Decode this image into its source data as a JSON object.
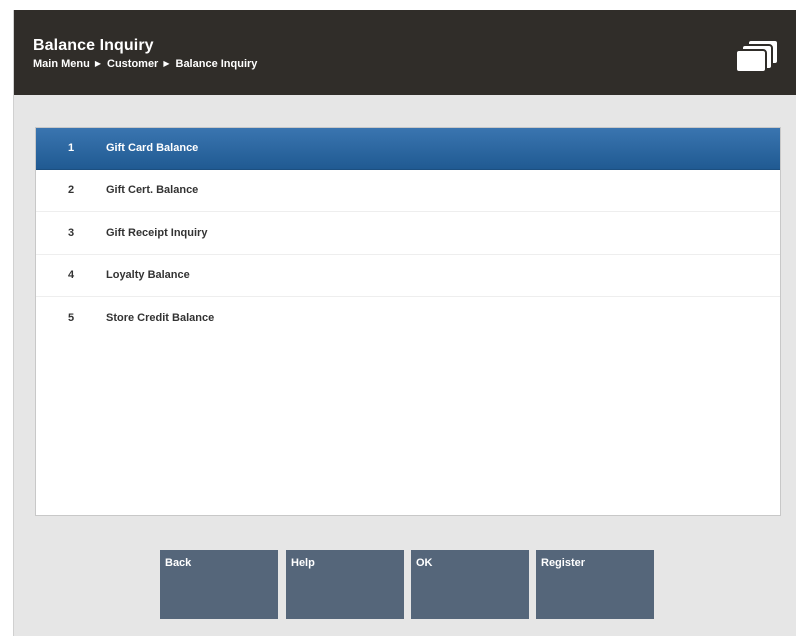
{
  "header": {
    "title": "Balance Inquiry",
    "breadcrumb": [
      "Main Menu",
      "Customer",
      "Balance Inquiry"
    ],
    "icon": "cards-icon"
  },
  "menu": {
    "selected_index": 0,
    "items": [
      {
        "number": "1",
        "label": "Gift Card Balance"
      },
      {
        "number": "2",
        "label": "Gift Cert. Balance"
      },
      {
        "number": "3",
        "label": "Gift Receipt Inquiry"
      },
      {
        "number": "4",
        "label": "Loyalty Balance"
      },
      {
        "number": "5",
        "label": "Store Credit Balance"
      }
    ]
  },
  "buttons": {
    "back": "Back",
    "help": "Help",
    "ok": "OK",
    "register": "Register"
  },
  "colors": {
    "header_bg": "#302d29",
    "selected_row": "#2e6aa3",
    "button_bg": "#55667a",
    "panel_bg": "#e6e6e6"
  }
}
